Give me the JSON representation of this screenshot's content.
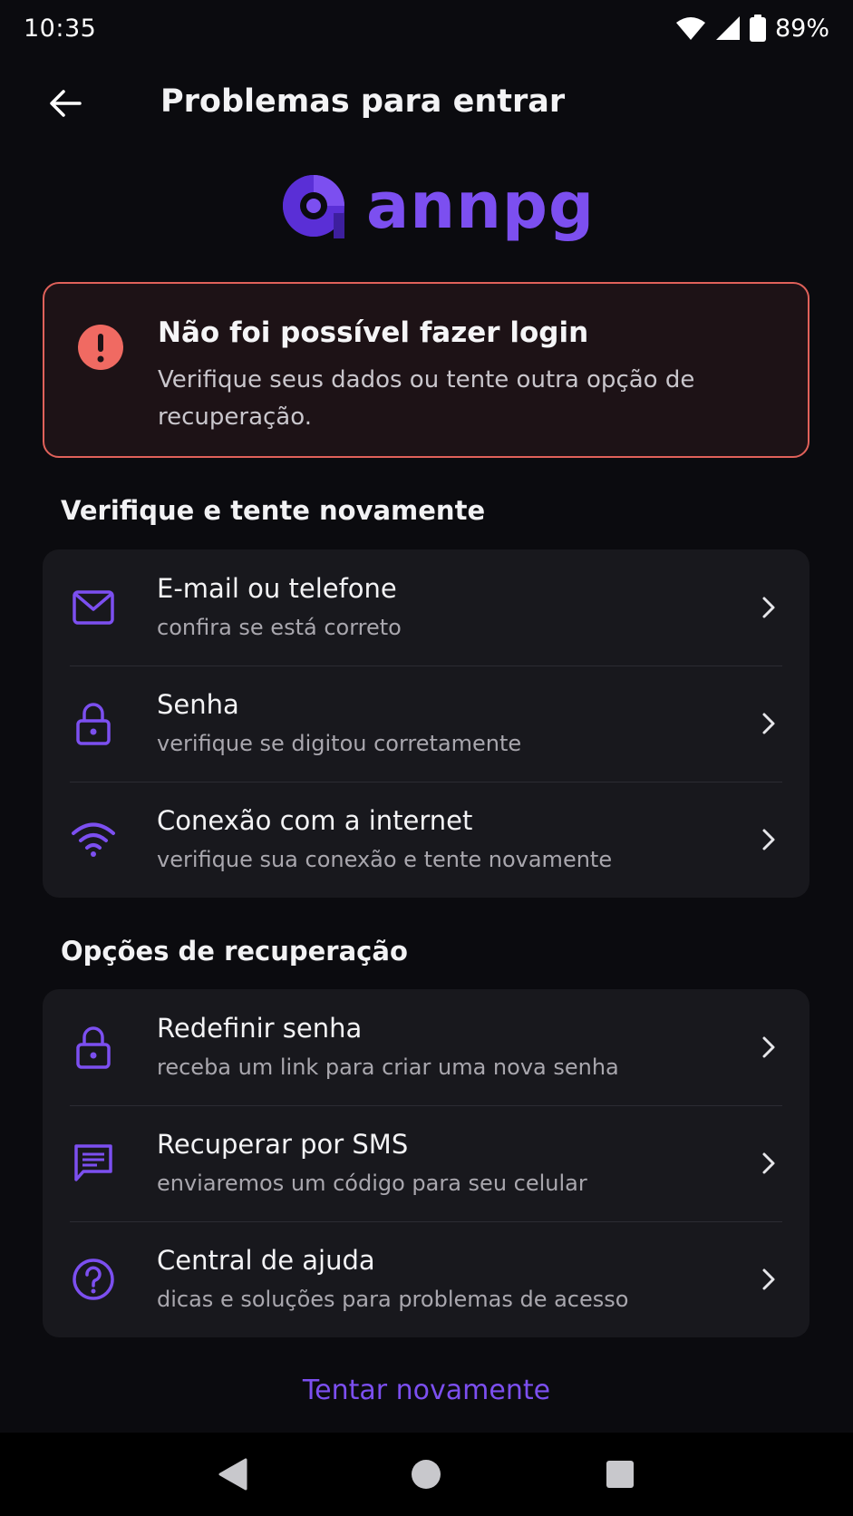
{
  "status": {
    "time": "10:35",
    "battery": "89%"
  },
  "header": {
    "title": "Problemas para entrar"
  },
  "logo": {
    "text": "annpg",
    "color": "#7c4ff0"
  },
  "error": {
    "title": "Não foi possível fazer login",
    "message": "Verifique seus dados ou tente outra opção de recuperação.",
    "color": "#e0615a"
  },
  "verify_section": {
    "title": "Verifique e tente novamente",
    "items": [
      {
        "icon": "mail-icon",
        "title": "E-mail ou telefone",
        "subtitle": "confira se está correto"
      },
      {
        "icon": "lock-icon",
        "title": "Senha",
        "subtitle": "verifique se digitou corretamente"
      },
      {
        "icon": "wifi-icon",
        "title": "Conexão com a internet",
        "subtitle": "verifique sua conexão e tente novamente"
      }
    ]
  },
  "recovery_section": {
    "title": "Opções de recuperação",
    "items": [
      {
        "icon": "lock-icon",
        "title": "Redefinir senha",
        "subtitle": "receba um link para criar uma nova senha"
      },
      {
        "icon": "sms-icon",
        "title": "Recuperar por SMS",
        "subtitle": "enviaremos um código para seu celular"
      },
      {
        "icon": "help-icon",
        "title": "Central de ajuda",
        "subtitle": "dicas e soluções para problemas de acesso"
      }
    ]
  },
  "retry": {
    "label": "Tentar novamente"
  }
}
